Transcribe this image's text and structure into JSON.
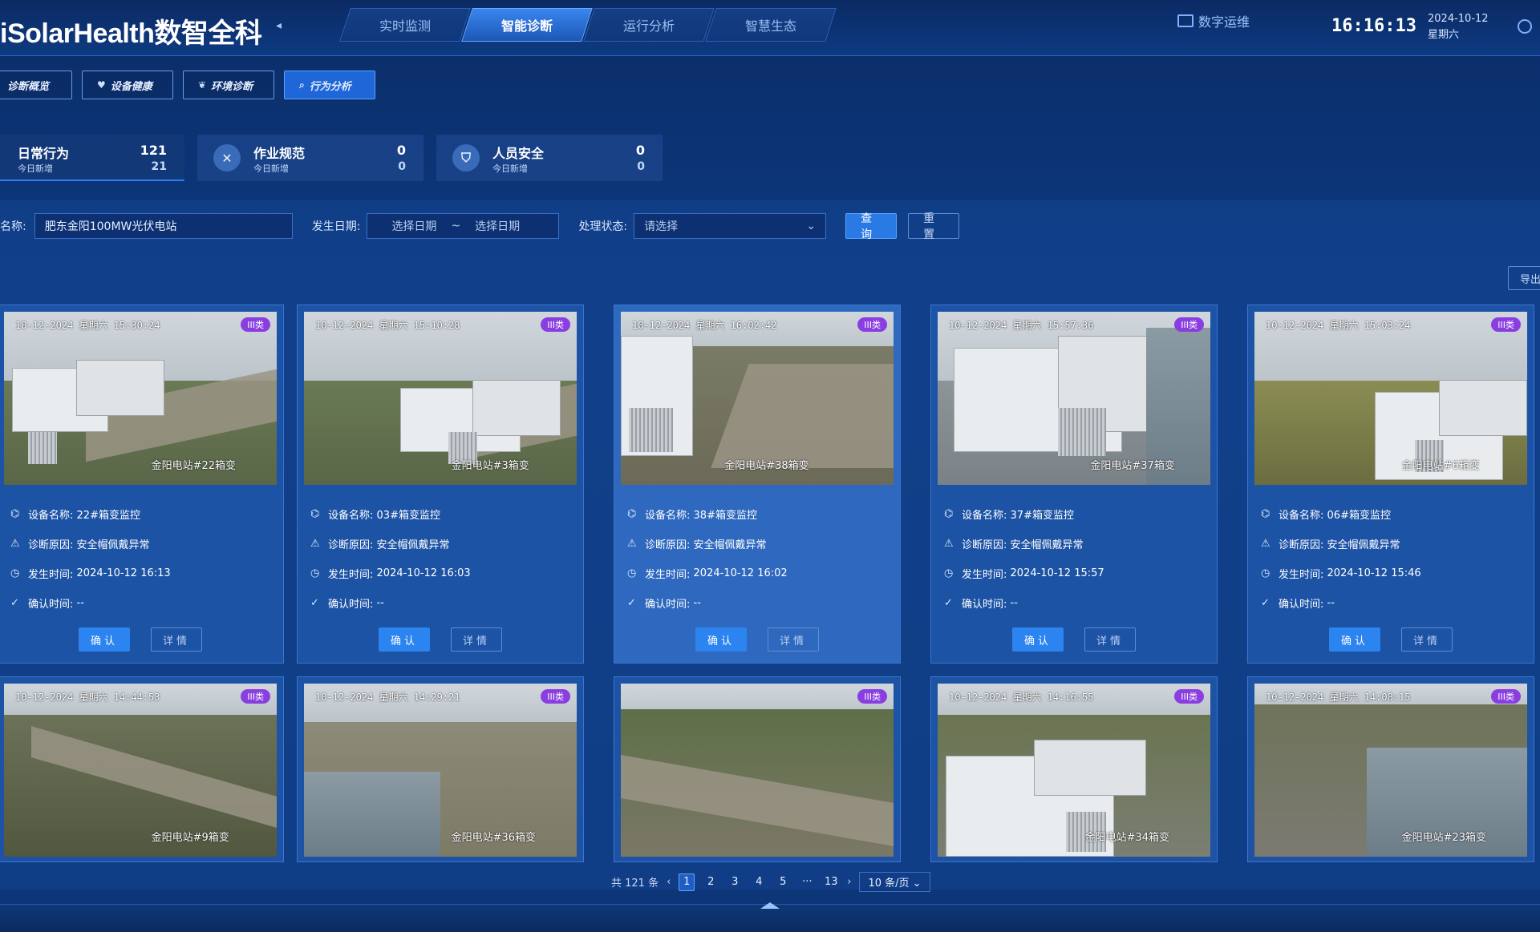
{
  "app": {
    "brand": "iSolarHealth数智全科",
    "nav_tabs": [
      "实时监测",
      "智能诊断",
      "运行分析",
      "智慧生态"
    ],
    "ops_label": "数字运维",
    "time": "16:16:13",
    "date": "2024-10-12",
    "weekday": "星期六"
  },
  "subtabs": [
    "诊断概览",
    "设备健康",
    "环境诊断",
    "行为分析"
  ],
  "stats": [
    {
      "label": "日常行为",
      "sub": "今日新增",
      "value": "121",
      "sub_value": "21"
    },
    {
      "label": "作业规范",
      "sub": "今日新增",
      "value": "0",
      "sub_value": "0"
    },
    {
      "label": "人员安全",
      "sub": "今日新增",
      "value": "0",
      "sub_value": "0"
    }
  ],
  "filter": {
    "station_label": "名称:",
    "station_value": "肥东金阳100MW光伏电站",
    "date_label": "发生日期:",
    "date_start": "选择日期",
    "date_sep": "~",
    "date_end": "选择日期",
    "status_label": "处理状态:",
    "status_placeholder": "请选择",
    "query": "查询",
    "reset": "重置",
    "export": "导出"
  },
  "card_labels": {
    "device": "设备名称:",
    "reason": "诊断原因:",
    "time": "发生时间:",
    "confirm_time": "确认时间:",
    "confirm": "确认",
    "detail": "详情",
    "class": "III类"
  },
  "cards": [
    {
      "ts": "10-12-2024 星期六 15:30:24",
      "loc": "金阳电站#22箱变",
      "device": "22#箱变监控",
      "reason": "安全帽佩戴异常",
      "time": "2024-10-12 16:13",
      "confirm_time": "--"
    },
    {
      "ts": "10-12-2024 星期六 15:10:28",
      "loc": "金阳电站#3箱变",
      "device": "03#箱变监控",
      "reason": "安全帽佩戴异常",
      "time": "2024-10-12 16:03",
      "confirm_time": "--"
    },
    {
      "ts": "10-12-2024 星期六 16:02:42",
      "loc": "金阳电站#38箱变",
      "device": "38#箱变监控",
      "reason": "安全帽佩戴异常",
      "time": "2024-10-12 16:02",
      "confirm_time": "--"
    },
    {
      "ts": "10-12-2024 星期六 15:57:36",
      "loc": "金阳电站#37箱变",
      "device": "37#箱变监控",
      "reason": "安全帽佩戴异常",
      "time": "2024-10-12 15:57",
      "confirm_time": "--"
    },
    {
      "ts": "10-12-2024 星期六 15:03:24",
      "loc": "金阳电站#6箱变",
      "device": "06#箱变监控",
      "reason": "安全帽佩戴异常",
      "time": "2024-10-12 15:46",
      "confirm_time": "--"
    },
    {
      "ts": "10-12-2024 星期六 14:44:53",
      "loc": "金阳电站#9箱变"
    },
    {
      "ts": "10-12-2024 星期六 14:29:21",
      "loc": "金阳电站#36箱变"
    },
    {
      "ts": "",
      "loc": ""
    },
    {
      "ts": "10-12-2024 星期六 14:16:55",
      "loc": "金阳电站#34箱变"
    },
    {
      "ts": "10-12-2024 星期六 14:08:15",
      "loc": "金阳电站#23箱变"
    }
  ],
  "pagination": {
    "total": "共 121 条",
    "pages": [
      "1",
      "2",
      "3",
      "4",
      "5",
      "···",
      "13"
    ],
    "current": "1",
    "page_size": "10 条/页"
  }
}
